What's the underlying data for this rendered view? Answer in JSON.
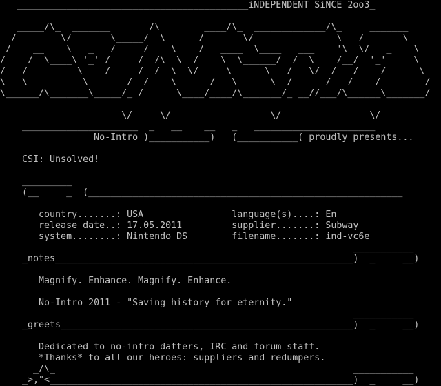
{
  "colors": {
    "background": "#000000",
    "text": "#c0c0c0"
  },
  "nfo": {
    "lines": [
      "   __________________________________________iNDEPENDENT SiNCE 2oo3_",
      "",
      "   _____/\\_  _______       /\\        ____/\\_  _____________/\\_     _______",
      "  /        \\/       \\_____/  \\      /       \\/               \\   /       \\",
      " /    __    \\   _   /     /    \\    /   ____  \\____   ___    '\\  \\/   _    \\",
      "/    /  \\____\\ '_' /     /  /\\  \\  /    \\  \\______/  /  \\    /__/  '_'     \\",
      "/   /         \\    /     /  /  \\  \\/     \\      \\   /   \\/  /   /    /      \\",
      "\\   \\          \\       /  /    \\      /   \\      \\  /      /   /    /        /",
      "\\______/\\_______\\_____/_ /      \\____/____/\\_______/_ __//___/\\______\\_______/",
      "",
      "                      \\/     \\/                  \\/                \\/",
      "    _____________________  _   __    __   _   ______________________",
      "                 No-Intro )___________)   (___________( proudly presents...",
      "",
      "    CSI: Unsolved!",
      "",
      "    _________",
      "    (__     _  (_________________________________________________________",
      "",
      "       country.......: USA                language(s)....: En",
      "       release date..: 17.05.2011         supplier.......: Subway",
      "       system........: Nintendo DS        filename.......: ind-vc6e",
      "                                                                ___________",
      "    _notes______________________________________________________)  _     __)",
      "",
      "       Magnify. Enhance. Magnify. Enhance.",
      "",
      "       No-Intro 2011 - \"Saving history for eternity.\"",
      "                                                                ___________",
      "    _greets_____________________________________________________)  _     __)",
      "",
      "       Dedicated to no-intro datters, IRC and forum staff.",
      "       *Thanks* to all our heroes: suppliers and redumpers.",
      "      _/\\_                                                      ___________",
      "    _>,\"<_______________________________________________________)  _     __)"
    ]
  }
}
